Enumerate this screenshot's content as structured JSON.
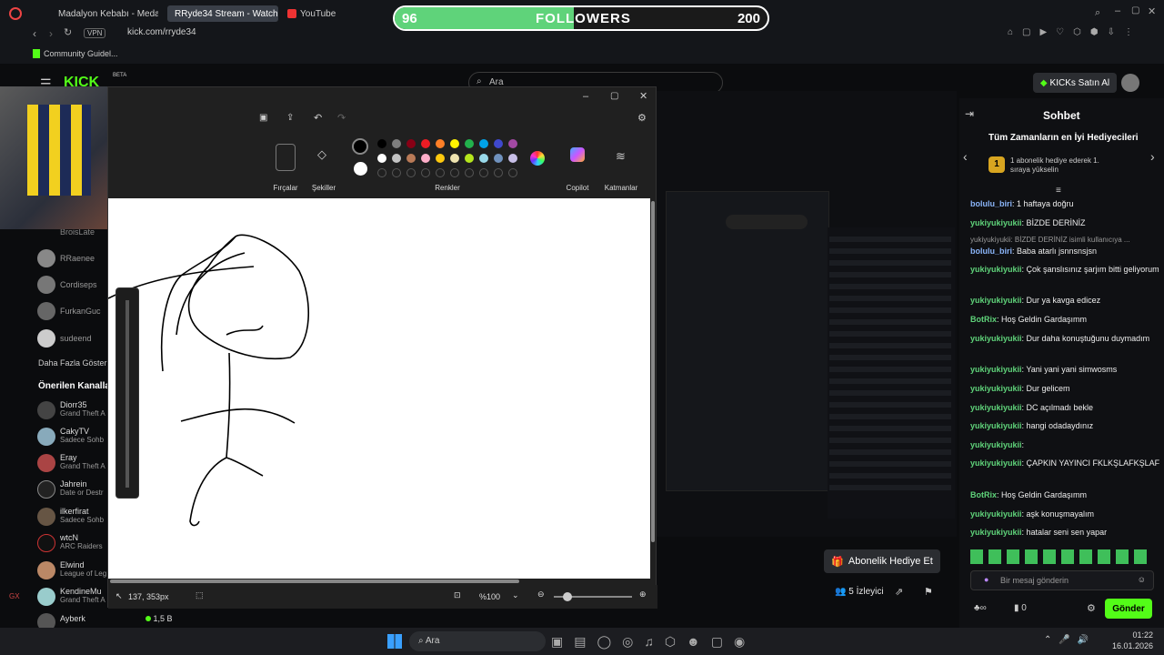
{
  "browser": {
    "tabs": [
      {
        "label": "Madalyon Kebabı - Medali"
      },
      {
        "label": "RRyde34 Stream - Watch"
      },
      {
        "label": "YouTube"
      }
    ],
    "url": "kick.com/rryde34",
    "vpn": "VPN",
    "bookmark": "Community Guidel..."
  },
  "followers_bar": {
    "current": "96",
    "label": "FOLLOWERS",
    "goal": "200",
    "progress": 0.48
  },
  "kick": {
    "logo": "KICK",
    "beta": "BETA",
    "search_placeholder": "Ara",
    "buy_kicks": "KICKs Satın Al",
    "goal_badge": "200",
    "sidebar_users": [
      {
        "name": "BroisLate",
        "sub": ""
      },
      {
        "name": "RRaenee",
        "sub": ""
      },
      {
        "name": "Cordiseps",
        "sub": ""
      },
      {
        "name": "FurkanGuc",
        "sub": ""
      },
      {
        "name": "sudeend",
        "sub": ""
      }
    ],
    "show_more": "Daha Fazla Göster",
    "recommended_title": "Önerilen Kanalla",
    "recommended": [
      {
        "name": "Diorr35",
        "sub": "Grand Theft A"
      },
      {
        "name": "CakyTV",
        "sub": "Sadece Sohb"
      },
      {
        "name": "Eray",
        "sub": "Grand Theft A"
      },
      {
        "name": "Jahrein",
        "sub": "Date or Destr"
      },
      {
        "name": "ilkerfirat",
        "sub": "Sadece Sohb"
      },
      {
        "name": "wtcN",
        "sub": "ARC Raiders"
      },
      {
        "name": "Elwind",
        "sub": "League of Leg"
      },
      {
        "name": "KendineMu",
        "sub": "Grand Theft A"
      },
      {
        "name": "Ayberk",
        "sub": ""
      }
    ],
    "ayberk_viewers": "1,5 B",
    "gift_sub": "Abonelik Hediye Et",
    "viewers": "5 İzleyici"
  },
  "paint": {
    "tools": [
      "Fırçalar",
      "Şekiller",
      "Renkler",
      "Copilot",
      "Katmanlar"
    ],
    "cursor_pos": "137, 353px",
    "zoom": "%100"
  },
  "chat": {
    "title": "Sohbet",
    "top_gifters": "Tüm Zamanların en İyi Hediyecileri",
    "gift_promo": "1 abonelik hediye ederek 1. sıraya yükselin",
    "rank": "1",
    "messages": [
      {
        "user": "bolulu_biri",
        "text": ": 1 haftaya doğru",
        "color": "blue"
      },
      {
        "user": "yukiyukiyukii",
        "text": ": BİZDE DERİNİZ",
        "color": "lime"
      },
      {
        "user": "",
        "text": "yukiyukiyukii: BİZDE DERİNİZ isimli kullanıcıya ...",
        "color": ""
      },
      {
        "user": "bolulu_biri",
        "text": ": Baba atarlı jsnnsnsjsn",
        "color": "blue"
      },
      {
        "user": "yukiyukiyukii",
        "text": ": Çok şanslısınız şarjım bitti geliyorum",
        "color": "lime"
      },
      {
        "user": "yukiyukiyukii",
        "text": ": Dur ya kavga edicez",
        "color": "lime"
      },
      {
        "user": "BotRix",
        "text": ": Hoş Geldin Gardaşımm",
        "color": "lime"
      },
      {
        "user": "yukiyukiyukii",
        "text": ": Dur daha konuştuğunu duymadım",
        "color": "lime"
      },
      {
        "user": "yukiyukiyukii",
        "text": ": Yani yani yani simwosms",
        "color": "lime"
      },
      {
        "user": "yukiyukiyukii",
        "text": ": Dur gelicem",
        "color": "lime"
      },
      {
        "user": "yukiyukiyukii",
        "text": ": DC açılmadı bekle",
        "color": "lime"
      },
      {
        "user": "yukiyukiyukii",
        "text": ": hangi odadaydınız",
        "color": "lime"
      },
      {
        "user": "yukiyukiyukii",
        "text": ":",
        "color": "lime"
      },
      {
        "user": "yukiyukiyukii",
        "text": ": ÇAPKIN YAYINCI FKLKŞLAFKŞLAF",
        "color": "lime"
      },
      {
        "user": "BotRix",
        "text": ": Hoş Geldin Gardaşımm",
        "color": "lime"
      },
      {
        "user": "yukiyukiyukii",
        "text": ": aşk konuşmayalım",
        "color": "lime"
      },
      {
        "user": "yukiyukiyukii",
        "text": ": hatalar seni sen yapar",
        "color": "lime"
      }
    ],
    "input_placeholder": "Bir mesaj gönderin",
    "send": "Gönder",
    "points": "0"
  },
  "taskbar": {
    "search": "Ara",
    "time": "01:22",
    "date": "16.01.2026"
  },
  "colors": {
    "accent": "#53fc18",
    "bg": "#0b0c0e"
  }
}
